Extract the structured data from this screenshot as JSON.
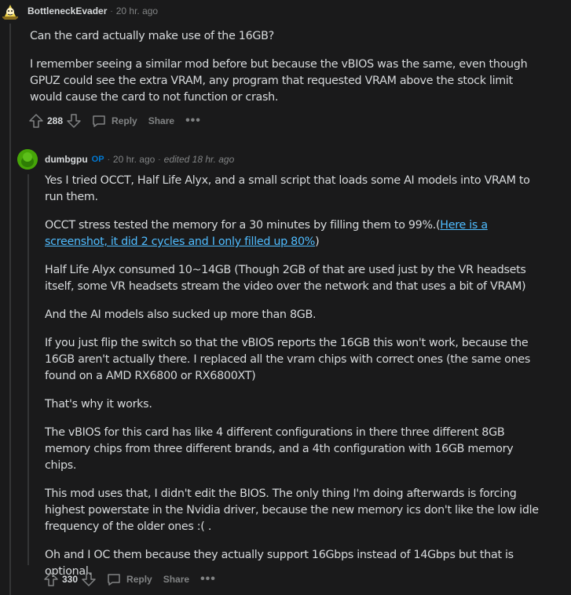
{
  "comment1": {
    "author": "BottleneckEvader",
    "time": "20 hr. ago",
    "paragraphs": [
      "Can the card actually make use of the 16GB?",
      "I remember seeing a similar mod before but because the vBIOS was the same, even though GPUZ could see the extra VRAM, any program that requested VRAM above the stock limit would cause the card to not function or crash."
    ],
    "votes": "288",
    "reply_label": "Reply",
    "share_label": "Share",
    "more_label": "•••"
  },
  "comment2": {
    "author": "dumbgpu",
    "op_tag": "OP",
    "time": "20 hr. ago",
    "edited": "edited 18 hr. ago",
    "p1": "Yes I tried OCCT, Half Life Alyx, and a small script that loads some AI models into VRAM to run them.",
    "p2_pre": "OCCT stress tested the memory for a 30 minutes by filling them to 99%.(",
    "p2_link": "Here is a screenshot, it did 2 cycles and I only filled up 80%",
    "p2_post": ")",
    "p3": "Half Life Alyx consumed 10~14GB (Though 2GB of that are used just by the VR headsets itself, some VR headsets stream the video over the network and that uses a bit of VRAM)",
    "p4": "And the AI models also sucked up more than 8GB.",
    "p5": "If you just flip the switch so that the vBIOS reports the 16GB this won't work, because the 16GB aren't actually there. I replaced all the vram chips with correct ones (the same ones found on a AMD RX6800 or RX6800XT)",
    "p6": "That's why it works.",
    "p7": "The vBIOS for this card has like 4 different configurations in there three different 8GB memory chips from three different brands, and a 4th configuration with 16GB memory chips.",
    "p8": "This mod uses that, I didn't edit the BIOS. The only thing I'm doing afterwards is forcing highest powerstate in the Nvidia driver, because the new memory ics don't like the low idle frequency of the older ones :( .",
    "p9": "Oh and I OC them because they actually support 16Gbps instead of 14Gbps but that is optional.",
    "votes": "330",
    "reply_label": "Reply",
    "share_label": "Share",
    "more_label": "•••"
  },
  "colors": {
    "background": "#1a1a1b",
    "text": "#d7dadc",
    "muted": "#818384",
    "link": "#4fbcff",
    "op": "#0079d3"
  },
  "icons": [
    "upvote-icon",
    "downvote-icon",
    "reply-icon",
    "more-icon",
    "avatar-icon"
  ]
}
